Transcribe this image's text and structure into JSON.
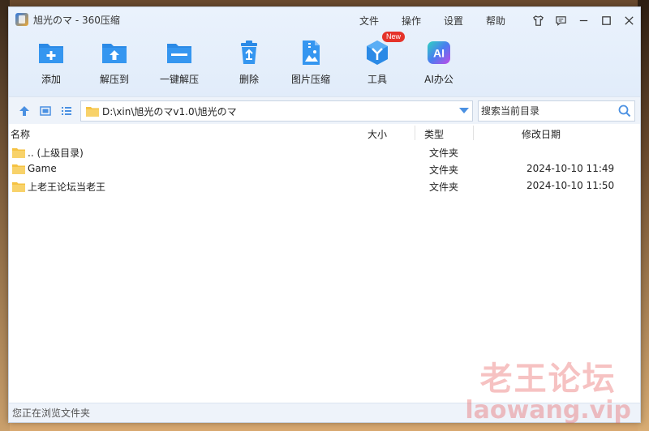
{
  "window": {
    "title": "旭光のマ - 360压缩"
  },
  "menu": [
    {
      "label": "文件",
      "name": "menu-file"
    },
    {
      "label": "操作",
      "name": "menu-operate"
    },
    {
      "label": "设置",
      "name": "menu-settings"
    },
    {
      "label": "帮助",
      "name": "menu-help"
    }
  ],
  "toolbar": {
    "add": "添加",
    "extract_to": "解压到",
    "one_click_extract": "一键解压",
    "delete": "删除",
    "image_compress": "图片压缩",
    "tools": "工具",
    "tools_badge": "New",
    "ai_office": "AI办公",
    "ai_icon_text": "AI"
  },
  "address": {
    "path": "D:\\xin\\旭光のマv1.0\\旭光のマ",
    "search_placeholder": "搜索当前目录"
  },
  "columns": {
    "name": "名称",
    "size": "大小",
    "type": "类型",
    "modified": "修改日期"
  },
  "rows": [
    {
      "name": ".. (上级目录)",
      "size": "",
      "type": "文件夹",
      "modified": ""
    },
    {
      "name": "Game",
      "size": "",
      "type": "文件夹",
      "modified": "2024-10-10 11:49"
    },
    {
      "name": "上老王论坛当老王",
      "size": "",
      "type": "文件夹",
      "modified": "2024-10-10 11:50"
    }
  ],
  "status": {
    "text": "您正在浏览文件夹"
  },
  "watermark": {
    "cn": "老王论坛",
    "en": "laowang.vip"
  },
  "colors": {
    "accent": "#2b8ae6",
    "folder": "#f5c242",
    "badge": "#e5332a"
  }
}
